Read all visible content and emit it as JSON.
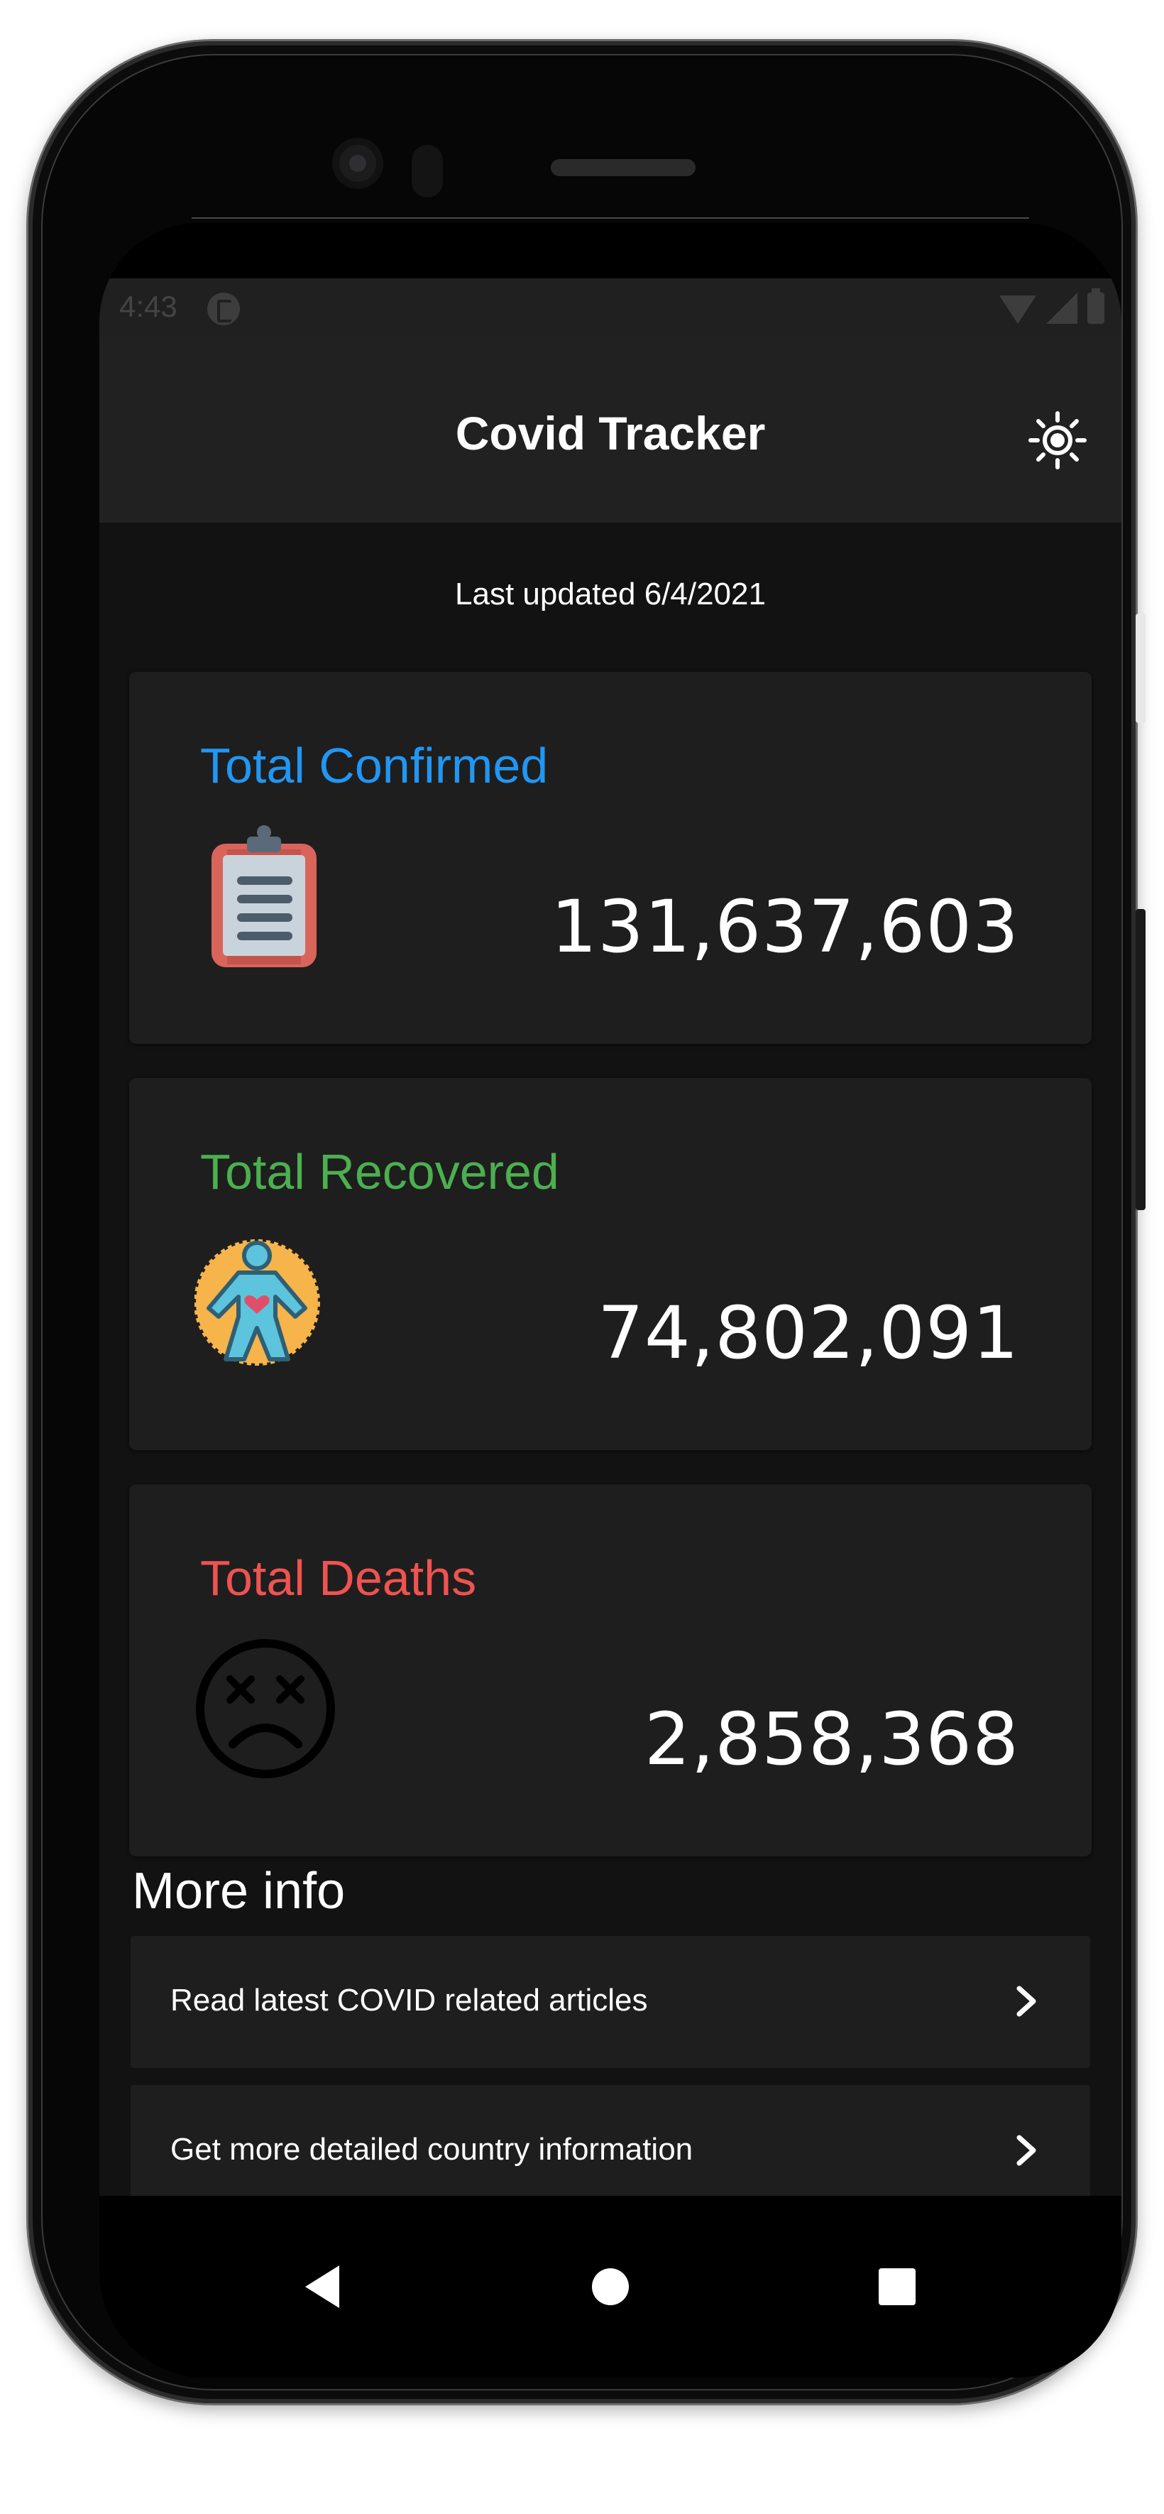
{
  "status_bar": {
    "time": "4:43"
  },
  "app_bar": {
    "title": "Covid Tracker",
    "theme_icon": "sun-icon"
  },
  "last_updated": "Last updated  6/4/2021",
  "stats": [
    {
      "label": "Total Confirmed",
      "value": "131,637,603",
      "color": "#2196f3",
      "icon": "clipboard-icon"
    },
    {
      "label": "Total Recovered",
      "value": "74,802,091",
      "color": "#4caf50",
      "icon": "healthy-person-icon"
    },
    {
      "label": "Total Deaths",
      "value": "2,858,368",
      "color": "#ef5350",
      "icon": "dead-face-icon"
    }
  ],
  "more_info": {
    "title": "More info",
    "links": [
      {
        "label": "Read latest COVID related articles",
        "icon": "chevron-right-icon"
      },
      {
        "label": "Get more detailed country information",
        "icon": "chevron-right-icon"
      }
    ]
  },
  "nav_bar": {
    "back_icon": "back-triangle-icon",
    "home_icon": "home-circle-icon",
    "recents_icon": "recents-square-icon"
  }
}
